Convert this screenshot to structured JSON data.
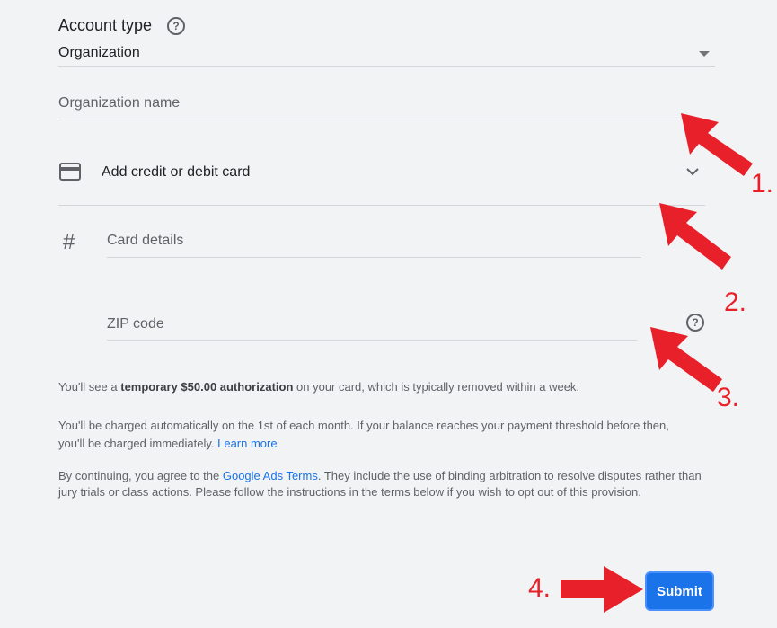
{
  "account_type": {
    "label": "Account type",
    "value": "Organization",
    "help_icon": "question-circle-icon",
    "dropdown_icon": "caret-down-icon"
  },
  "organization_name": {
    "placeholder": "Organization name"
  },
  "card_section": {
    "icon": "credit-card-icon",
    "label": "Add credit or debit card",
    "chevron_icon": "chevron-down-icon"
  },
  "card_details": {
    "icon": "hash-icon",
    "placeholder": "Card details"
  },
  "zip_code": {
    "placeholder": "ZIP code",
    "help_icon": "question-circle-icon"
  },
  "notice1": {
    "prefix": "You'll see a ",
    "bold": "temporary $50.00 authorization",
    "suffix": " on your card, which is typically removed within a week."
  },
  "notice2": {
    "line1": "You'll be charged automatically on the 1st of each month. If your balance reaches your payment threshold before then,",
    "line2_prefix": "you'll be charged immediately. ",
    "link": "Learn more"
  },
  "notice3": {
    "prefix": "By continuing, you agree to the ",
    "link": "Google Ads Terms",
    "suffix": ". They include the use of binding arbitration to resolve disputes rather than jury trials or class actions. Please follow the instructions in the terms below if you wish to opt out of this provision."
  },
  "annotations": {
    "step1": "1.",
    "step2": "2.",
    "step3": "3.",
    "step4": "4.",
    "arrow_color": "#e8202a"
  },
  "submit": {
    "label": "Submit",
    "color": "#1a73e8"
  }
}
